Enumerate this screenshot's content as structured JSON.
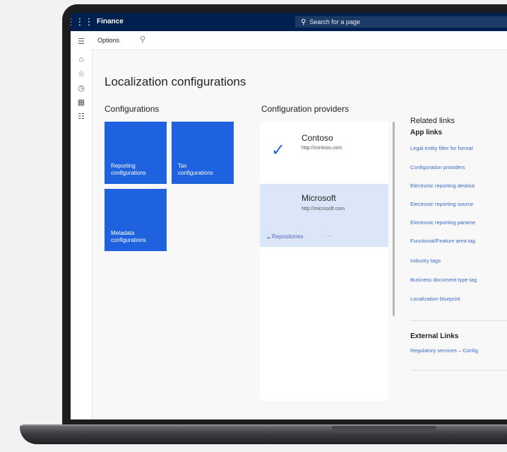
{
  "app": {
    "title": "Finance"
  },
  "search": {
    "placeholder": "Search for a page"
  },
  "actionbar": {
    "options_label": "Options"
  },
  "page": {
    "title": "Localization configurations"
  },
  "configurations": {
    "heading": "Configurations",
    "tiles": [
      {
        "line1": "Reporting",
        "line2": "configurations"
      },
      {
        "line1": "Tax",
        "line2": "configurations"
      },
      {
        "line1": "Metadata",
        "line2": "configurations"
      }
    ]
  },
  "providers": {
    "heading": "Configuration providers",
    "items": [
      {
        "name": "Contoso",
        "url": "http://contoso.com"
      },
      {
        "name": "Microsoft",
        "url": "http://microsoft.com",
        "action": "Repositories",
        "more": "···"
      }
    ]
  },
  "related": {
    "heading": "Related links",
    "app_links_heading": "App links",
    "app_links": [
      "Legal entity filter for format",
      "Configuration providers",
      "Electronic reporting destina",
      "Electronic reporting source",
      "Electronic reporting parame",
      "Functional/Feature area tag",
      "Industry tags",
      "Business document type tag",
      "Localization blueprint"
    ],
    "external_heading": "External Links",
    "external_links": [
      "Regulatory services – Config"
    ]
  },
  "colors": {
    "topbar": "#002050",
    "tile": "#1f62e0",
    "link": "#3a6ad0",
    "selected": "#dbe6f9"
  }
}
